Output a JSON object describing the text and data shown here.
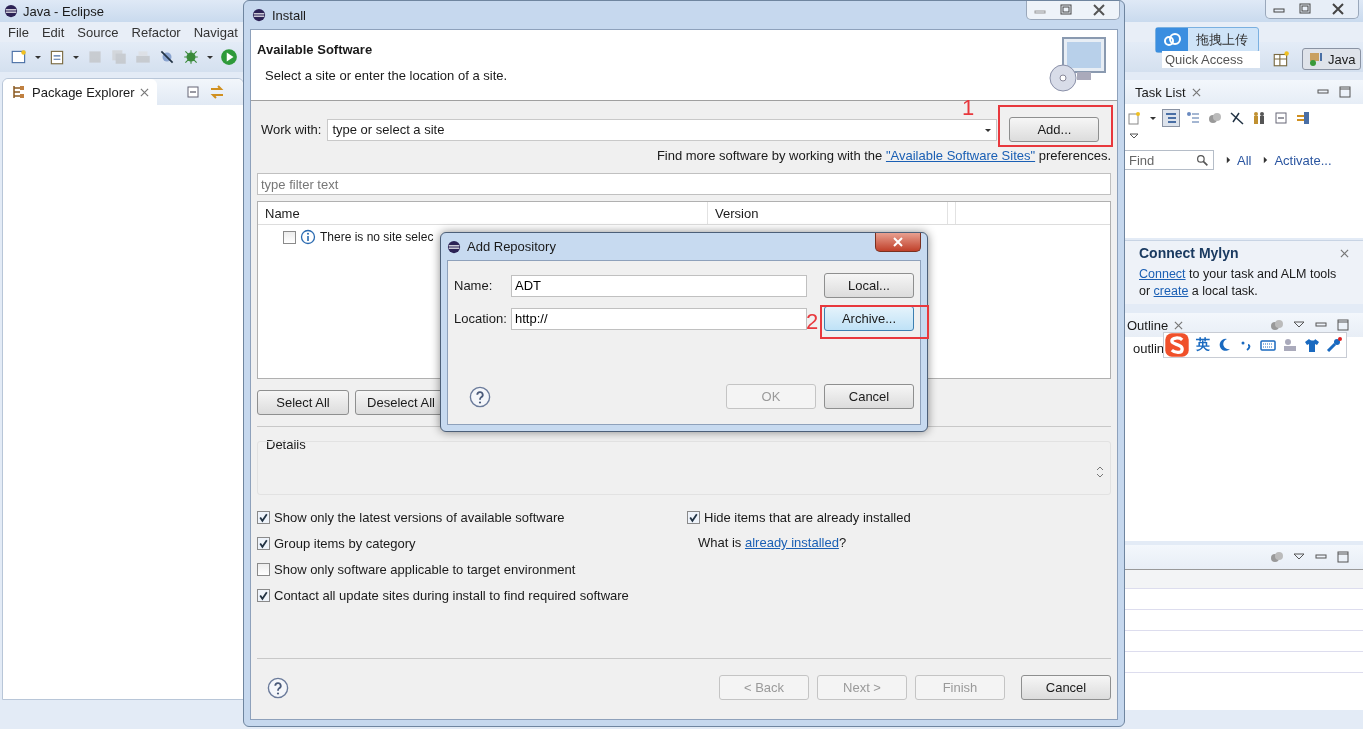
{
  "eclipse": {
    "title": "Java - Eclipse",
    "menu": [
      "File",
      "Edit",
      "Source",
      "Refactor",
      "Navigat"
    ],
    "package_explorer": {
      "tab": "Package Explorer"
    },
    "upload_button": "拖拽上传",
    "quick_access": {
      "placeholder": "Quick Access"
    },
    "perspective": {
      "label": "Java",
      "selected": true
    },
    "task_list": {
      "tab": "Task List",
      "find": {
        "placeholder": "Find"
      },
      "links": [
        "All",
        "Activate..."
      ]
    },
    "mylyn": {
      "title": "Connect Mylyn",
      "text": [
        {
          "kind": "link",
          "text": "Connect"
        },
        {
          "kind": "text",
          "text": " to your task and ALM tools or "
        },
        {
          "kind": "link",
          "text": "create"
        },
        {
          "kind": "text",
          "text": " a local task."
        }
      ]
    },
    "outline": {
      "tab": "Outline",
      "message": "outlin"
    },
    "ime_bar": {
      "language": "英"
    }
  },
  "install": {
    "title": "Install",
    "heading": "Available Software",
    "subtitle": "Select a site or enter the location of a site.",
    "work_with": {
      "label": "Work with:",
      "value": "type or select a site"
    },
    "add_button": "Add...",
    "more_sites": [
      {
        "kind": "text",
        "text": "Find more software by working with the "
      },
      {
        "kind": "link",
        "text": "\"Available Software Sites\""
      },
      {
        "kind": "text",
        "text": " preferences."
      }
    ],
    "filter": {
      "placeholder": "type filter text"
    },
    "table": {
      "columns": [
        "Name",
        "Version"
      ],
      "rows": [
        {
          "checked": false,
          "name": "There is no site selec"
        }
      ]
    },
    "select_buttons": [
      "Select All",
      "Deselect All"
    ],
    "details": {
      "label": "Details"
    },
    "options": [
      {
        "label": "Show only the latest versions of available software",
        "checked": true
      },
      {
        "label": "Group items by category",
        "checked": true
      },
      {
        "label": "Show only software applicable to target environment",
        "checked": false
      },
      {
        "label": "Contact all update sites during install to find required software",
        "checked": true
      }
    ],
    "hide_installed": {
      "label": "Hide items that are already installed",
      "checked": true
    },
    "what_is": [
      {
        "kind": "text",
        "text": "What is "
      },
      {
        "kind": "link",
        "text": "already installed"
      },
      {
        "kind": "text",
        "text": "?"
      }
    ],
    "buttons": [
      {
        "label": "< Back",
        "disabled": true
      },
      {
        "label": "Next >",
        "disabled": true
      },
      {
        "label": "Finish",
        "disabled": true
      },
      {
        "label": "Cancel",
        "disabled": false
      }
    ]
  },
  "add_repository": {
    "title": "Add Repository",
    "name": {
      "label": "Name:",
      "value": "ADT",
      "button": "Local..."
    },
    "location": {
      "label": "Location:",
      "value": "http://",
      "button": "Archive..."
    },
    "buttons": [
      {
        "label": "OK",
        "disabled": true
      },
      {
        "label": "Cancel",
        "disabled": false
      }
    ]
  },
  "annotations": [
    {
      "label": "1"
    },
    {
      "label": "2"
    }
  ]
}
